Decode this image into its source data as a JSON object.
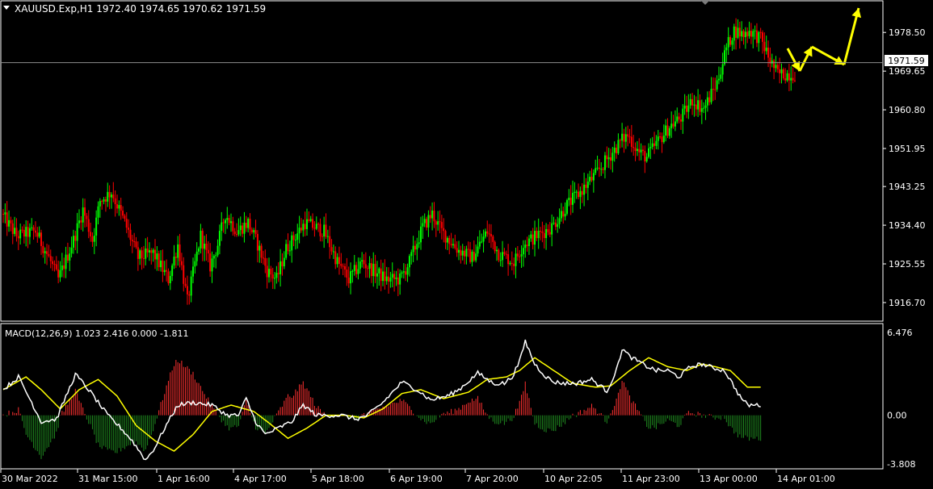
{
  "header": {
    "symbol_line": "XAUUSD.Exp,H1  1972.40 1974.65 1970.62 1971.59",
    "current_price_label": "1971.59"
  },
  "macd": {
    "label": "MACD(12,26,9) 1.023 2.416 0.000 -1.811"
  },
  "colors": {
    "background": "#000000",
    "bull_candle": "#00ff00",
    "bear_candle": "#ff0000",
    "macd_line": "#ffffff",
    "signal_line": "#ffff00",
    "hist_positive": "#ff3030",
    "hist_negative": "#1f8a1f",
    "arrows": "#ffff00",
    "price_line": "#8e8e8e",
    "axis": "#ffffff"
  },
  "chart_data": [
    {
      "type": "candlestick",
      "title": "XAUUSD.Exp,H1",
      "ylim": [
        1913.0,
        1985.0
      ],
      "y_ticks": [
        "1978.50",
        "1969.65",
        "1960.80",
        "1951.95",
        "1943.25",
        "1934.40",
        "1925.55",
        "1916.70"
      ],
      "x_ticks": [
        "30 Mar 2022",
        "31 Mar 15:00",
        "1 Apr 16:00",
        "4 Apr 17:00",
        "5 Apr 18:00",
        "6 Apr 19:00",
        "7 Apr 20:00",
        "10 Apr 22:05",
        "11 Apr 23:00",
        "13 Apr 00:00",
        "14 Apr 01:00"
      ],
      "current_price": 1971.59,
      "path_anchors": [
        [
          0,
          1937
        ],
        [
          8,
          1932
        ],
        [
          18,
          1933
        ],
        [
          25,
          1927
        ],
        [
          30,
          1922
        ],
        [
          38,
          1931
        ],
        [
          43,
          1938
        ],
        [
          48,
          1931
        ],
        [
          52,
          1940
        ],
        [
          58,
          1942
        ],
        [
          65,
          1935
        ],
        [
          72,
          1927
        ],
        [
          80,
          1928
        ],
        [
          88,
          1922
        ],
        [
          93,
          1930
        ],
        [
          98,
          1917
        ],
        [
          105,
          1932
        ],
        [
          110,
          1925
        ],
        [
          114,
          1930
        ],
        [
          118,
          1937
        ],
        [
          124,
          1933
        ],
        [
          130,
          1935
        ],
        [
          135,
          1930
        ],
        [
          140,
          1924
        ],
        [
          145,
          1922
        ],
        [
          150,
          1929
        ],
        [
          155,
          1932
        ],
        [
          160,
          1935
        ],
        [
          170,
          1933
        ],
        [
          177,
          1926
        ],
        [
          183,
          1922
        ],
        [
          190,
          1926
        ],
        [
          196,
          1924
        ],
        [
          203,
          1922
        ],
        [
          210,
          1922
        ],
        [
          215,
          1926
        ],
        [
          222,
          1934
        ],
        [
          227,
          1937
        ],
        [
          232,
          1933
        ],
        [
          240,
          1929
        ],
        [
          248,
          1927
        ],
        [
          256,
          1933
        ],
        [
          262,
          1928
        ],
        [
          270,
          1926
        ],
        [
          275,
          1930
        ],
        [
          282,
          1932
        ],
        [
          290,
          1934
        ],
        [
          298,
          1939
        ],
        [
          305,
          1942
        ],
        [
          313,
          1946
        ],
        [
          320,
          1950
        ],
        [
          327,
          1954
        ],
        [
          330,
          1955
        ],
        [
          336,
          1951
        ],
        [
          340,
          1950
        ],
        [
          345,
          1953
        ],
        [
          352,
          1957
        ],
        [
          358,
          1959
        ],
        [
          364,
          1963
        ],
        [
          370,
          1961
        ],
        [
          377,
          1967
        ],
        [
          382,
          1975
        ],
        [
          386,
          1979
        ],
        [
          391,
          1978
        ],
        [
          394,
          1979
        ],
        [
          400,
          1977
        ],
        [
          405,
          1972
        ],
        [
          409,
          1969
        ]
      ]
    },
    {
      "type": "macd",
      "title": "MACD(12,26,9)",
      "ylim": [
        -3.808,
        6.476
      ],
      "y_ticks": [
        "6.476",
        "0.00",
        "-3.808"
      ],
      "macd_anchors": [
        [
          0,
          2
        ],
        [
          8,
          3
        ],
        [
          15,
          1
        ],
        [
          20,
          -0.5
        ],
        [
          28,
          -0.3
        ],
        [
          38,
          3.2
        ],
        [
          45,
          2
        ],
        [
          50,
          1
        ],
        [
          55,
          0
        ],
        [
          62,
          -1
        ],
        [
          68,
          -2
        ],
        [
          75,
          -3.5
        ],
        [
          80,
          -2.5
        ],
        [
          85,
          -1
        ],
        [
          92,
          0.8
        ],
        [
          100,
          1
        ],
        [
          110,
          0.8
        ],
        [
          118,
          0
        ],
        [
          124,
          0
        ],
        [
          128,
          1.3
        ],
        [
          133,
          -0.5
        ],
        [
          138,
          -1.5
        ],
        [
          145,
          -1
        ],
        [
          152,
          -0.5
        ],
        [
          158,
          0.8
        ],
        [
          165,
          0
        ],
        [
          178,
          0
        ],
        [
          186,
          -0.3
        ],
        [
          192,
          0
        ],
        [
          200,
          1
        ],
        [
          210,
          2.6
        ],
        [
          218,
          2
        ],
        [
          225,
          1.2
        ],
        [
          234,
          1.5
        ],
        [
          240,
          2
        ],
        [
          250,
          3.3
        ],
        [
          258,
          2.5
        ],
        [
          264,
          2.5
        ],
        [
          268,
          3
        ],
        [
          272,
          4.2
        ],
        [
          275,
          5.8
        ],
        [
          280,
          4
        ],
        [
          286,
          3
        ],
        [
          290,
          2.6
        ],
        [
          296,
          2.5
        ],
        [
          302,
          2.5
        ],
        [
          310,
          2.8
        ],
        [
          318,
          1.9
        ],
        [
          323,
          3.5
        ],
        [
          326,
          5.2
        ],
        [
          330,
          4.6
        ],
        [
          338,
          3.9
        ],
        [
          344,
          3.5
        ],
        [
          350,
          3.5
        ],
        [
          356,
          3
        ],
        [
          362,
          3.8
        ],
        [
          368,
          4
        ],
        [
          374,
          3.7
        ],
        [
          380,
          3.5
        ],
        [
          384,
          2.5
        ],
        [
          388,
          1.5
        ],
        [
          392,
          0.8
        ]
      ],
      "signal_anchors": [
        [
          0,
          2
        ],
        [
          12,
          3
        ],
        [
          20,
          2
        ],
        [
          30,
          0.5
        ],
        [
          40,
          2
        ],
        [
          50,
          2.8
        ],
        [
          60,
          1.5
        ],
        [
          70,
          -0.8
        ],
        [
          80,
          -2
        ],
        [
          90,
          -2.8
        ],
        [
          100,
          -1.5
        ],
        [
          110,
          0.3
        ],
        [
          120,
          0.8
        ],
        [
          132,
          0.3
        ],
        [
          140,
          -0.6
        ],
        [
          150,
          -1.8
        ],
        [
          160,
          -1
        ],
        [
          170,
          0
        ],
        [
          180,
          0
        ],
        [
          190,
          -0.2
        ],
        [
          200,
          0.5
        ],
        [
          210,
          1.7
        ],
        [
          220,
          2
        ],
        [
          232,
          1.3
        ],
        [
          245,
          1.8
        ],
        [
          255,
          2.8
        ],
        [
          265,
          3
        ],
        [
          272,
          3.5
        ],
        [
          280,
          4.5
        ],
        [
          290,
          3.5
        ],
        [
          300,
          2.5
        ],
        [
          312,
          2.2
        ],
        [
          320,
          2.3
        ],
        [
          330,
          3.5
        ],
        [
          340,
          4.5
        ],
        [
          350,
          3.8
        ],
        [
          360,
          3.5
        ],
        [
          368,
          4
        ],
        [
          375,
          3.8
        ],
        [
          383,
          3.5
        ],
        [
          392,
          2.2
        ]
      ]
    }
  ],
  "annotation": {
    "arrow_points": [
      [
        975,
        60
      ],
      [
        990,
        88
      ],
      [
        1005,
        58
      ],
      [
        1045,
        80
      ],
      [
        1063,
        10
      ]
    ]
  }
}
